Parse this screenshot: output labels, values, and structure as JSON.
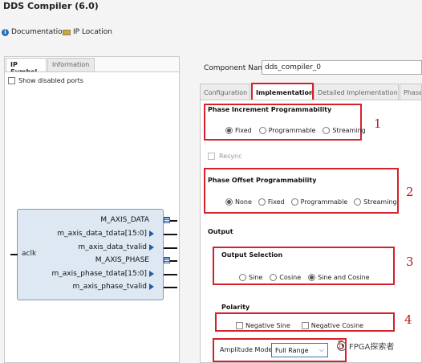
{
  "window": {
    "title": "DDS Compiler (6.0)"
  },
  "header": {
    "documentation_label": "Documentation",
    "ip_location_label": "IP Location"
  },
  "left_panel": {
    "tabs": [
      {
        "label": "IP Symbol",
        "active": true
      },
      {
        "label": "Information",
        "active": false
      }
    ],
    "show_disabled_ports_label": "Show disabled ports",
    "symbol": {
      "input_port": "aclk",
      "output_ports": [
        {
          "label": "M_AXIS_DATA",
          "kind": "bus"
        },
        {
          "label": "m_axis_data_tdata[15:0]",
          "kind": "arrow"
        },
        {
          "label": "m_axis_data_tvalid",
          "kind": "arrow"
        },
        {
          "label": "M_AXIS_PHASE",
          "kind": "bus"
        },
        {
          "label": "m_axis_phase_tdata[15:0]",
          "kind": "arrow"
        },
        {
          "label": "m_axis_phase_tvalid",
          "kind": "arrow"
        }
      ]
    }
  },
  "component": {
    "label": "Component Name",
    "value": "dds_compiler_0"
  },
  "right_panel": {
    "tabs": [
      {
        "label": "Configuration",
        "active": false
      },
      {
        "label": "Implementation",
        "active": true
      },
      {
        "label": "Detailed Implementation",
        "active": false
      },
      {
        "label": "Phase",
        "active": false
      }
    ],
    "phase_increment": {
      "title": "Phase Increment Programmability",
      "options": [
        {
          "label": "Fixed",
          "selected": true
        },
        {
          "label": "Programmable",
          "selected": false
        },
        {
          "label": "Streaming",
          "selected": false
        }
      ],
      "marker": "1"
    },
    "resync_label": "Resync",
    "phase_offset": {
      "title": "Phase Offset Programmability",
      "options": [
        {
          "label": "None",
          "selected": true
        },
        {
          "label": "Fixed",
          "selected": false
        },
        {
          "label": "Programmable",
          "selected": false
        },
        {
          "label": "Streaming",
          "selected": false
        }
      ],
      "marker": "2"
    },
    "output_title": "Output",
    "output_selection": {
      "title": "Output Selection",
      "options": [
        {
          "label": "Sine",
          "selected": false
        },
        {
          "label": "Cosine",
          "selected": false
        },
        {
          "label": "Sine and Cosine",
          "selected": true
        }
      ],
      "marker": "3"
    },
    "polarity": {
      "title": "Polarity",
      "options": [
        {
          "label": "Negative Sine",
          "checked": false
        },
        {
          "label": "Negative Cosine",
          "checked": false
        }
      ],
      "marker": "4"
    },
    "amplitude": {
      "label": "Amplitude Mode",
      "value": "Full Range",
      "marker": "5"
    }
  },
  "watermark": {
    "text": "FPGA探索者"
  },
  "colors": {
    "highlight_box": "#d6212b",
    "symbol_fill": "#dde8f3",
    "pin_arrow": "#1f5fa8"
  }
}
